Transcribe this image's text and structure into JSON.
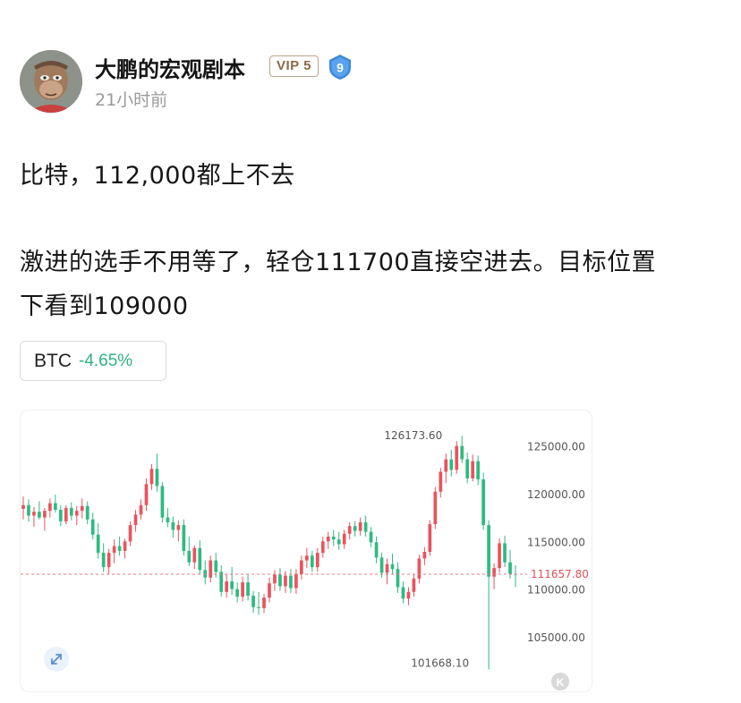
{
  "author": {
    "name": "大鹏的宏观剧本",
    "vip_label": "VIP 5",
    "level": "9",
    "time": "21小时前"
  },
  "post": {
    "line1": "比特，112,000都上不去",
    "line2": "激进的选手不用等了，轻仓111700直接空进去。目标位置",
    "line3": "下看到109000"
  },
  "ticker": {
    "symbol": "BTC",
    "change": "-4.65%"
  },
  "colors": {
    "up": "#e8545e",
    "down": "#2eba82",
    "change_positive_text": "#2fb47f",
    "current_price_line": "#e57b83",
    "level_badge": "#3f8bd8"
  },
  "icons": {
    "expand": "expand-arrows-icon",
    "logo": "k-logo-icon"
  },
  "chart_data": {
    "type": "candlestick",
    "y_ticks": [
      "125000.00",
      "120000.00",
      "115000.00",
      "110000.00",
      "105000.00"
    ],
    "y_tick_values": [
      125000,
      120000,
      115000,
      110000,
      105000
    ],
    "ylim": [
      100500,
      127500
    ],
    "high_annotation": {
      "label": "126173.60",
      "value": 126173.6
    },
    "low_annotation": {
      "label": "101668.10",
      "value": 101668.1
    },
    "current_price": {
      "label": "111657.80",
      "value": 111657.8
    },
    "candles": [
      [
        118500,
        119800,
        117400,
        118900
      ],
      [
        118900,
        119500,
        117200,
        117800
      ],
      [
        117800,
        118700,
        116600,
        118200
      ],
      [
        118200,
        119300,
        117400,
        117600
      ],
      [
        117600,
        118600,
        116200,
        118300
      ],
      [
        118300,
        119600,
        117600,
        119100
      ],
      [
        119100,
        120000,
        118100,
        118400
      ],
      [
        118400,
        118900,
        116700,
        117200
      ],
      [
        117200,
        118900,
        116900,
        118600
      ],
      [
        118600,
        119200,
        117300,
        117800
      ],
      [
        117800,
        118800,
        116800,
        118300
      ],
      [
        118300,
        119600,
        117500,
        118800
      ],
      [
        118800,
        119300,
        116900,
        117400
      ],
      [
        117400,
        118100,
        115300,
        115800
      ],
      [
        115800,
        117000,
        113300,
        113900
      ],
      [
        113900,
        114900,
        111900,
        112400
      ],
      [
        112400,
        114300,
        111700,
        113900
      ],
      [
        113900,
        115300,
        112800,
        114600
      ],
      [
        114600,
        115600,
        113600,
        114100
      ],
      [
        114100,
        115400,
        113300,
        115100
      ],
      [
        115100,
        117200,
        114600,
        116800
      ],
      [
        116800,
        118400,
        116100,
        117900
      ],
      [
        117900,
        119500,
        117400,
        118900
      ],
      [
        118900,
        121700,
        118300,
        121100
      ],
      [
        121100,
        123200,
        120500,
        122700
      ],
      [
        122700,
        124300,
        120300,
        120900
      ],
      [
        120900,
        121300,
        117100,
        117600
      ],
      [
        117600,
        118600,
        116600,
        117100
      ],
      [
        117100,
        117700,
        115500,
        116300
      ],
      [
        116300,
        117300,
        115100,
        116800
      ],
      [
        116800,
        117400,
        113600,
        114100
      ],
      [
        114100,
        115600,
        112500,
        112900
      ],
      [
        112900,
        114700,
        112200,
        114400
      ],
      [
        114400,
        115200,
        111600,
        112100
      ],
      [
        112100,
        113100,
        110600,
        111300
      ],
      [
        111300,
        113600,
        110800,
        113100
      ],
      [
        113100,
        113900,
        111300,
        111900
      ],
      [
        111900,
        112600,
        109300,
        109800
      ],
      [
        109800,
        111700,
        109200,
        110900
      ],
      [
        110900,
        112400,
        109500,
        110100
      ],
      [
        110100,
        110800,
        108700,
        109300
      ],
      [
        109300,
        111400,
        108800,
        110800
      ],
      [
        110800,
        111700,
        108900,
        109400
      ],
      [
        109400,
        109900,
        107600,
        108200
      ],
      [
        108200,
        109800,
        107400,
        108100
      ],
      [
        108100,
        109600,
        107600,
        109200
      ],
      [
        109200,
        111300,
        108700,
        110700
      ],
      [
        110700,
        112100,
        109900,
        111600
      ],
      [
        111600,
        112300,
        109900,
        110400
      ],
      [
        110400,
        112000,
        109700,
        111500
      ],
      [
        111500,
        112200,
        109700,
        110200
      ],
      [
        110200,
        112200,
        109600,
        111700
      ],
      [
        111700,
        113600,
        111100,
        113100
      ],
      [
        113100,
        114400,
        112300,
        113600
      ],
      [
        113600,
        114100,
        111900,
        112400
      ],
      [
        112400,
        114400,
        111900,
        113900
      ],
      [
        113900,
        115600,
        113400,
        115100
      ],
      [
        115100,
        116100,
        114300,
        115600
      ],
      [
        115600,
        116300,
        114600,
        115300
      ],
      [
        115300,
        116100,
        114200,
        114800
      ],
      [
        114800,
        116300,
        114300,
        115900
      ],
      [
        115900,
        117100,
        115300,
        116700
      ],
      [
        116700,
        117200,
        115600,
        116200
      ],
      [
        116200,
        117600,
        115700,
        117100
      ],
      [
        117100,
        117800,
        115600,
        116100
      ],
      [
        116100,
        116600,
        114500,
        115000
      ],
      [
        115000,
        115600,
        112800,
        113400
      ],
      [
        113400,
        113900,
        111300,
        111800
      ],
      [
        111800,
        113300,
        110600,
        112700
      ],
      [
        112700,
        113800,
        111700,
        112200
      ],
      [
        112200,
        112900,
        109700,
        110300
      ],
      [
        110300,
        110900,
        108600,
        109100
      ],
      [
        109100,
        110300,
        108400,
        109800
      ],
      [
        109800,
        111700,
        109300,
        111200
      ],
      [
        111200,
        113700,
        110700,
        113300
      ],
      [
        113300,
        114500,
        112600,
        114000
      ],
      [
        114000,
        117300,
        113600,
        116900
      ],
      [
        116900,
        120800,
        116400,
        120300
      ],
      [
        120300,
        122800,
        119700,
        122400
      ],
      [
        122400,
        124300,
        121200,
        123700
      ],
      [
        123700,
        124700,
        121900,
        122600
      ],
      [
        122600,
        125600,
        122200,
        125100
      ],
      [
        125100,
        126173.6,
        123300,
        123700
      ],
      [
        123700,
        124400,
        121200,
        121700
      ],
      [
        121700,
        124200,
        121400,
        123500
      ],
      [
        123500,
        124100,
        121000,
        121600
      ],
      [
        121600,
        122300,
        116300,
        116800
      ],
      [
        116800,
        117300,
        101668.1,
        111400
      ],
      [
        111400,
        112800,
        110100,
        112300
      ],
      [
        112300,
        115400,
        111800,
        114900
      ],
      [
        114900,
        115700,
        112400,
        112900
      ],
      [
        112900,
        114200,
        111200,
        111700
      ],
      [
        111700,
        112600,
        110300,
        111657.8
      ]
    ]
  }
}
